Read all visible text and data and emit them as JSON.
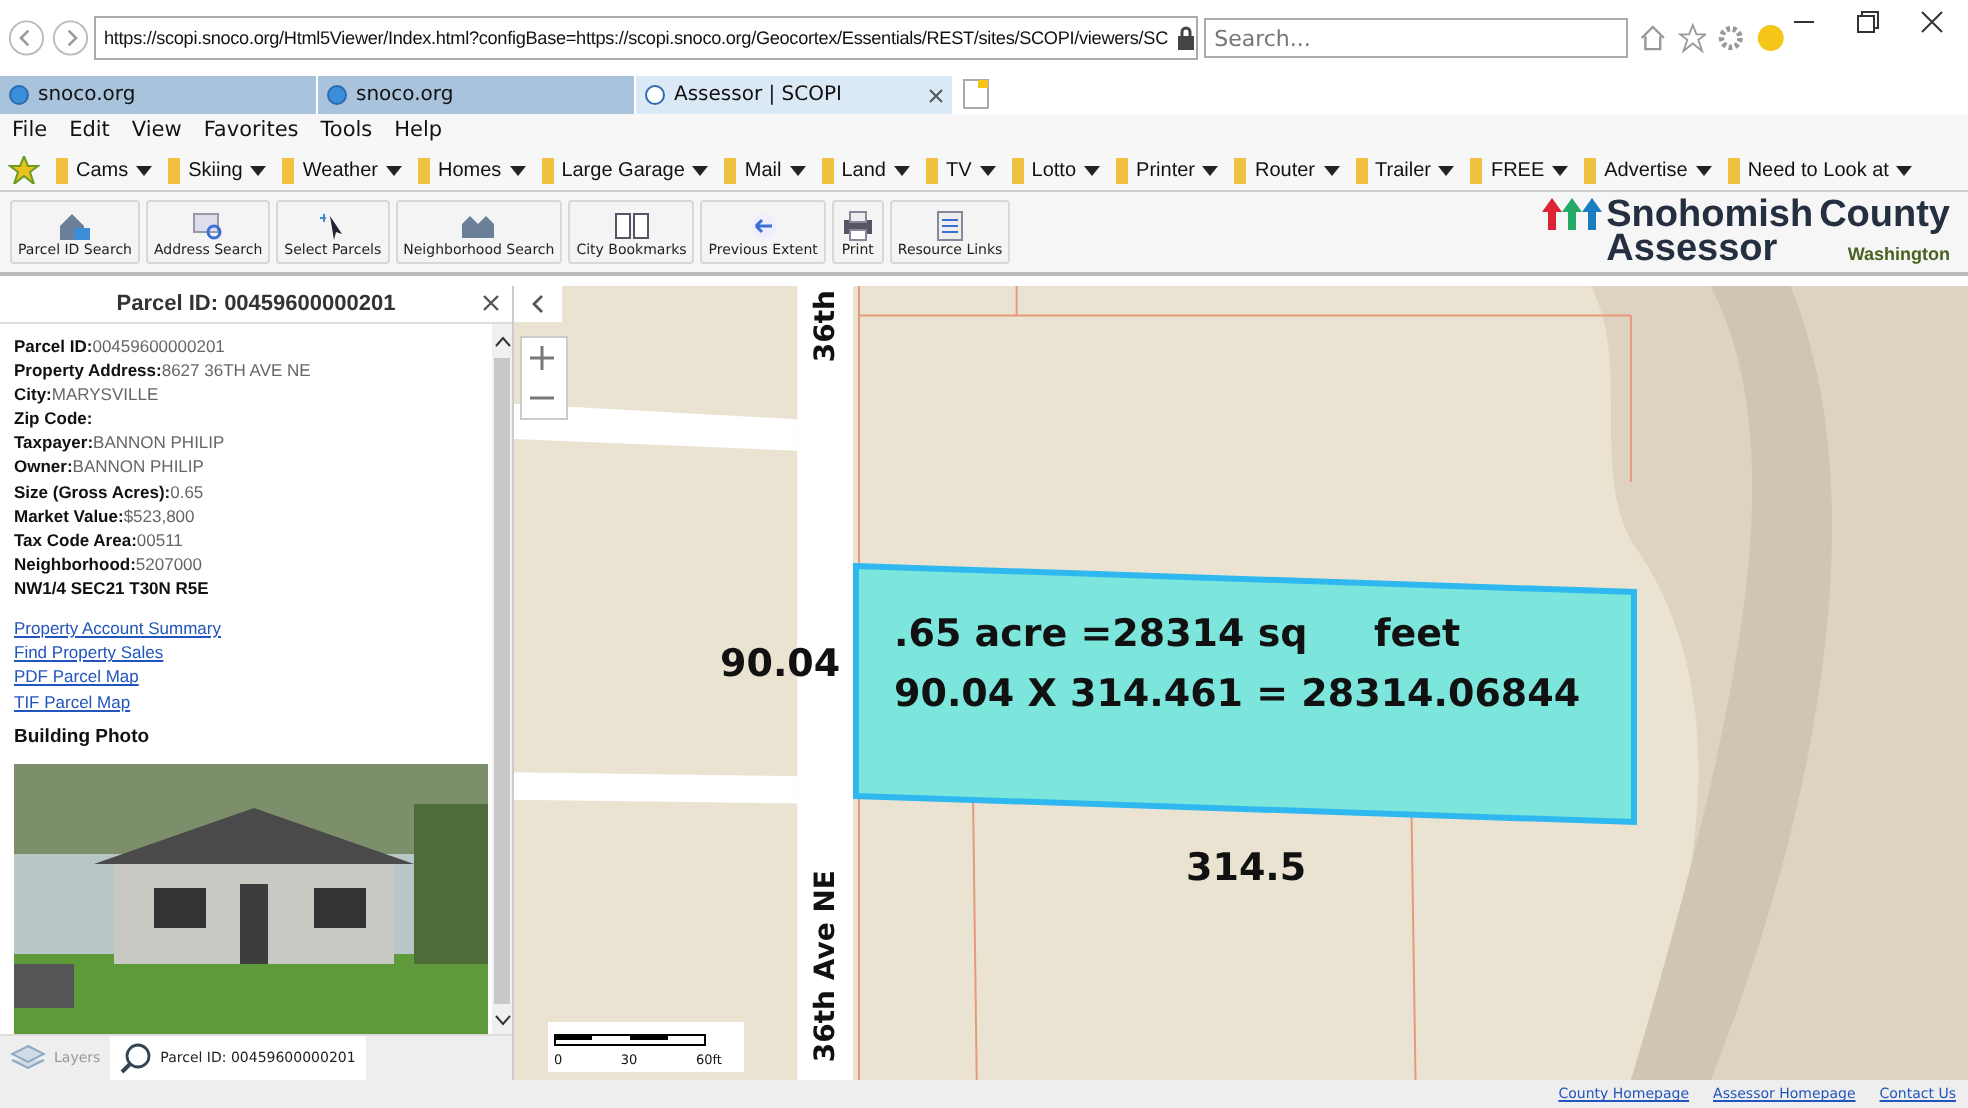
{
  "browser": {
    "address": "https://scopi.snoco.org/Html5Viewer/Index.html?configBase=https://scopi.snoco.org/Geocortex/Essentials/REST/sites/SCOPI/viewers/SC",
    "search_placeholder": "Search...",
    "tabs": [
      {
        "label": "snoco.org",
        "selected": false
      },
      {
        "label": "snoco.org",
        "selected": false
      },
      {
        "label": "Assessor | SCOPI",
        "selected": true
      }
    ],
    "menu": [
      "File",
      "Edit",
      "View",
      "Favorites",
      "Tools",
      "Help"
    ],
    "favorites": [
      "Cams",
      "Skiing",
      "Weather",
      "Homes",
      "Large Garage",
      "Mail",
      "Land",
      "TV",
      "Lotto",
      "Printer",
      "Router",
      "Trailer",
      "FREE",
      "Advertise",
      "Need to Look at"
    ]
  },
  "toolbar": [
    "Parcel ID Search",
    "Address Search",
    "Select Parcels",
    "Neighborhood Search",
    "City Bookmarks",
    "Previous Extent",
    "Print",
    "Resource Links"
  ],
  "logo": {
    "line1a": "Snohomish",
    "line1b": "County",
    "line2": "Assessor",
    "state": "Washington"
  },
  "panel": {
    "title": "Parcel ID: 00459600000201",
    "fields": [
      {
        "label": "Parcel ID:",
        "value": "00459600000201"
      },
      {
        "label": "Property Address:",
        "value": "8627 36TH AVE NE"
      },
      {
        "label": "City:",
        "value": "MARYSVILLE"
      },
      {
        "label": "Zip Code:"
      },
      {
        "label": "Taxpayer:",
        "value": "BANNON PHILIP"
      },
      {
        "label": "Owner:",
        "value": "BANNON PHILIP"
      },
      {
        "label": "Size (Gross Acres):",
        "value": "0.65"
      },
      {
        "label": "Market Value:",
        "value": "$523,800"
      },
      {
        "label": "Tax Code Area:",
        "value": "00511"
      },
      {
        "label": "Neighborhood:",
        "value": "5207000"
      }
    ],
    "legal": "NW1/4 SEC21 T30N R5E",
    "links": [
      "Property Account Summary",
      "Find Property Sales",
      "PDF Parcel Map",
      "TIF Parcel Map"
    ],
    "photo_heading": "Building Photo"
  },
  "bottom_tabs": [
    {
      "label": "Layers",
      "selected": false
    },
    {
      "label": "Parcel ID: 00459600000201",
      "selected": true
    }
  ],
  "map": {
    "streets": [
      "36th",
      "36th Ave NE"
    ],
    "width_label": "90.04",
    "length_label": "314.5",
    "parcel_text": [
      ".65 acre =28314 sq",
      "feet",
      "90.04 X 314.461 = 28314.06844"
    ],
    "scale": [
      "0",
      "30",
      "60ft"
    ]
  },
  "footer": [
    "County Homepage",
    "Assessor Homepage",
    "Contact Us"
  ]
}
